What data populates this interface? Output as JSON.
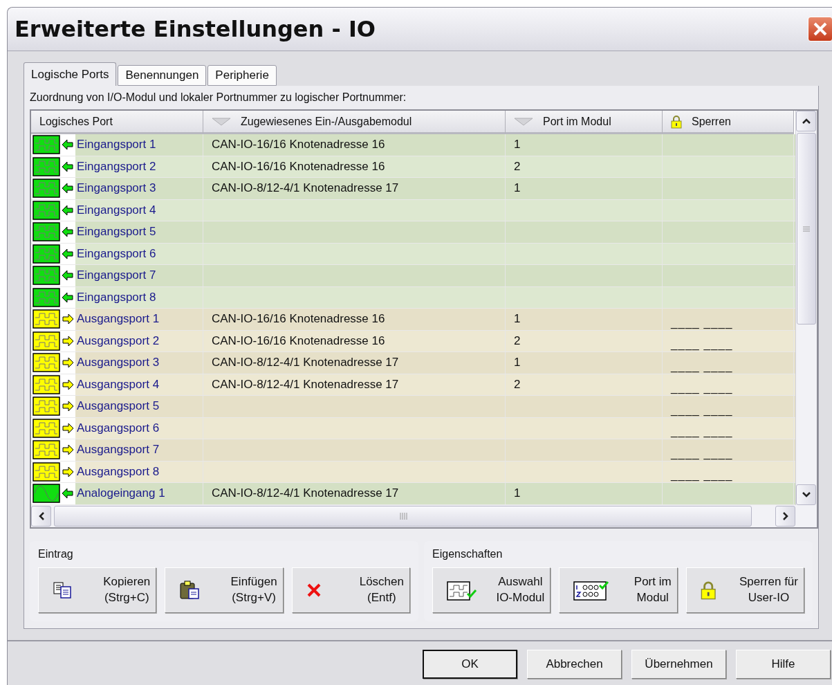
{
  "window": {
    "title": "Erweiterte Einstellungen - IO"
  },
  "tabs": [
    {
      "label": "Logische Ports",
      "selected": true
    },
    {
      "label": "Benennungen",
      "selected": false
    },
    {
      "label": "Peripherie",
      "selected": false
    }
  ],
  "table_caption": "Zuordnung von I/O-Modul und lokaler Portnummer zu logischer Portnummer:",
  "table": {
    "columns": [
      "Logisches Port",
      "Zugewiesenes Ein-/Ausgabemodul",
      "Port im Modul",
      "Sperren"
    ],
    "rows": [
      {
        "kind": "input",
        "port": "Eingangsport 1",
        "module": "CAN-IO-16/16 Knotenadresse 16",
        "module_port": "1"
      },
      {
        "kind": "input",
        "port": "Eingangsport 2",
        "module": "CAN-IO-16/16 Knotenadresse 16",
        "module_port": "2"
      },
      {
        "kind": "input",
        "port": "Eingangsport 3",
        "module": "CAN-IO-8/12-4/1 Knotenadresse 17",
        "module_port": "1"
      },
      {
        "kind": "input",
        "port": "Eingangsport 4"
      },
      {
        "kind": "input",
        "port": "Eingangsport 5"
      },
      {
        "kind": "input",
        "port": "Eingangsport 6"
      },
      {
        "kind": "input",
        "port": "Eingangsport 7"
      },
      {
        "kind": "input",
        "port": "Eingangsport 8"
      },
      {
        "kind": "output",
        "port": "Ausgangsport 1",
        "module": "CAN-IO-16/16 Knotenadresse 16",
        "module_port": "1",
        "lock": "____ ____"
      },
      {
        "kind": "output",
        "port": "Ausgangsport 2",
        "module": "CAN-IO-16/16 Knotenadresse 16",
        "module_port": "2",
        "lock": "____ ____"
      },
      {
        "kind": "output",
        "port": "Ausgangsport 3",
        "module": "CAN-IO-8/12-4/1 Knotenadresse 17",
        "module_port": "1",
        "lock": "____ ____"
      },
      {
        "kind": "output",
        "port": "Ausgangsport 4",
        "module": "CAN-IO-8/12-4/1 Knotenadresse 17",
        "module_port": "2",
        "lock": "____ ____"
      },
      {
        "kind": "output",
        "port": "Ausgangsport 5",
        "lock": "____ ____"
      },
      {
        "kind": "output",
        "port": "Ausgangsport 6",
        "lock": "____ ____"
      },
      {
        "kind": "output",
        "port": "Ausgangsport 7",
        "lock": "____ ____"
      },
      {
        "kind": "output",
        "port": "Ausgangsport 8",
        "lock": "____ ____"
      },
      {
        "kind": "analog_input",
        "port": "Analogeingang 1",
        "module": "CAN-IO-8/12-4/1 Knotenadresse 17",
        "module_port": "1"
      }
    ]
  },
  "groups": [
    {
      "title": "Eintrag",
      "buttons": [
        {
          "label": "Kopieren",
          "shortcut": "(Strg+C)"
        },
        {
          "label": "Einfügen",
          "shortcut": "(Strg+V)"
        },
        {
          "label": "Löschen",
          "shortcut": "(Entf)"
        }
      ]
    },
    {
      "title": "Eigenschaften",
      "buttons": [
        {
          "label": "Auswahl",
          "shortcut": "IO-Modul"
        },
        {
          "label": "Port im",
          "shortcut": "Modul"
        },
        {
          "label": "Sperren für",
          "shortcut": "User-IO"
        }
      ]
    }
  ],
  "dialog_buttons": [
    {
      "label": "OK",
      "default": true
    },
    {
      "label": "Abbrechen",
      "default": false
    },
    {
      "label": "Übernehmen",
      "default": false
    },
    {
      "label": "Hilfe",
      "default": false
    }
  ]
}
